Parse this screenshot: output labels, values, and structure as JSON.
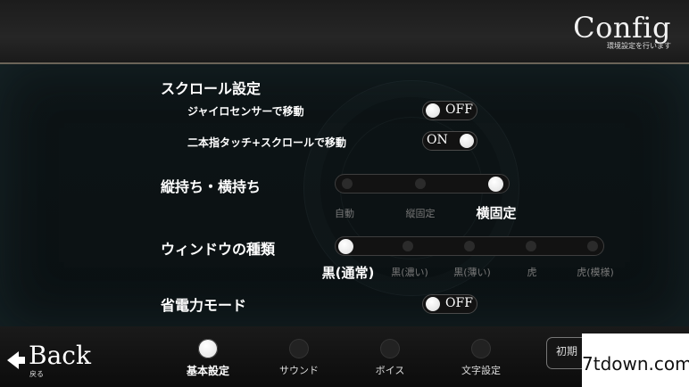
{
  "header": {
    "title": "Config",
    "subtitle": "環境設定を行います"
  },
  "scroll_section": {
    "title": "スクロール設定",
    "items": [
      {
        "label": "ジャイロセンサーで移動",
        "state": "OFF"
      },
      {
        "label": "二本指タッチ+スクロールで移動",
        "state": "ON"
      }
    ]
  },
  "orientation": {
    "title": "縦持ち・横持ち",
    "options": [
      "自動",
      "縦固定",
      "横固定"
    ],
    "selected": "横固定"
  },
  "window_type": {
    "title": "ウィンドウの種類",
    "options": [
      "黒(通常)",
      "黒(濃い)",
      "黒(薄い)",
      "虎",
      "虎(模様)"
    ],
    "selected": "黒(通常)"
  },
  "power_save": {
    "title": "省電力モード",
    "state": "OFF"
  },
  "footer": {
    "back_label": "Back",
    "back_sub": "戻る",
    "tabs": [
      {
        "label": "基本設定",
        "active": true
      },
      {
        "label": "サウンド",
        "active": false
      },
      {
        "label": "ボイス",
        "active": false
      },
      {
        "label": "文字設定",
        "active": false
      }
    ],
    "init_label": "初期"
  },
  "watermark": "7tdown.com"
}
